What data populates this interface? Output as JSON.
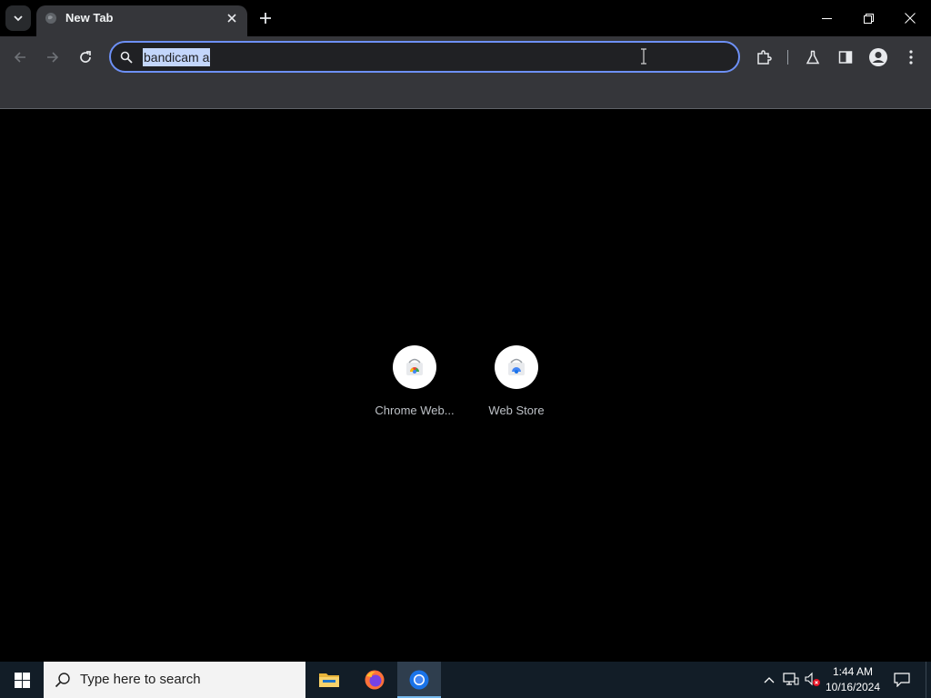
{
  "browser": {
    "tab": {
      "title": "New Tab"
    },
    "omnibox": {
      "value": "bandicam a"
    }
  },
  "new_tab_page": {
    "shortcuts": [
      {
        "label": "Chrome Web...",
        "icon": "chrome-web-store-icon"
      },
      {
        "label": "Web Store",
        "icon": "web-store-icon"
      }
    ]
  },
  "taskbar": {
    "search": {
      "placeholder": "Type here to search"
    },
    "apps": [
      {
        "name": "File Explorer",
        "icon": "file-explorer-icon",
        "active": false
      },
      {
        "name": "Firefox",
        "icon": "firefox-icon",
        "active": false
      },
      {
        "name": "Google Chrome",
        "icon": "chrome-icon",
        "active": true
      }
    ],
    "clock": {
      "time": "1:44 AM",
      "date": "10/16/2024"
    }
  },
  "colors": {
    "tabstrip_bg": "#000000",
    "toolbar_bg": "#35363a",
    "omnibox_border": "#6d90f6",
    "selection_bg": "#c3d6fb",
    "page_bg": "#000000",
    "taskbar_bg": "#121d27"
  }
}
